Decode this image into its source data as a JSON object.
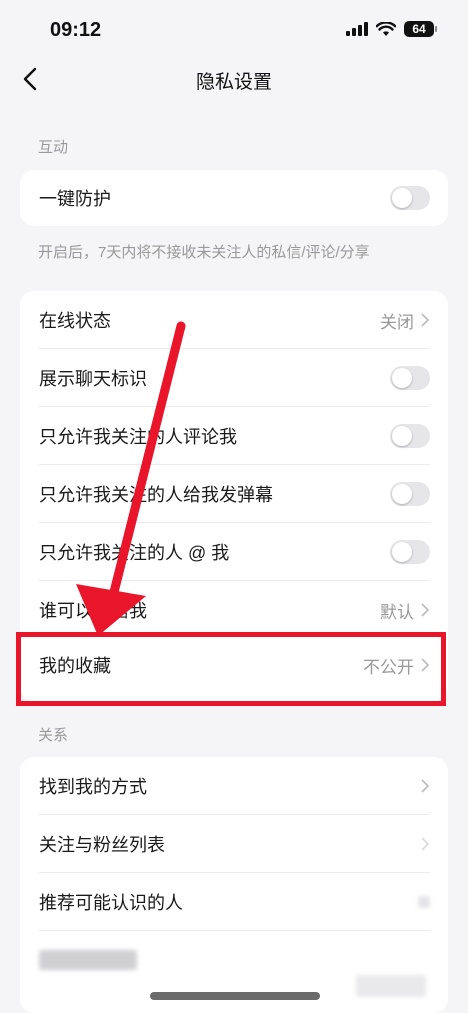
{
  "status": {
    "time": "09:12",
    "battery": "64"
  },
  "header": {
    "title": "隐私设置"
  },
  "sections": {
    "interaction_label": "互动",
    "relation_label": "关系"
  },
  "protection": {
    "label": "一键防护",
    "note": "开启后，7天内将不接收未关注人的私信/评论/分享"
  },
  "settings": {
    "online_status": {
      "label": "在线状态",
      "value": "关闭"
    },
    "show_chat_badge": {
      "label": "展示聊天标识"
    },
    "only_followed_comment": {
      "label": "只允许我关注的人评论我"
    },
    "only_followed_danmaku": {
      "label": "只允许我关注的人给我发弹幕"
    },
    "only_followed_mention": {
      "label": "只允许我关注的人 @ 我"
    },
    "who_can_message": {
      "label": "谁可以私信我",
      "value": "默认"
    },
    "my_favorites": {
      "label": "我的收藏",
      "value": "不公开"
    }
  },
  "relations": {
    "find_me": {
      "label": "找到我的方式"
    },
    "follow_list": {
      "label": "关注与粉丝列表"
    },
    "recommend": {
      "label": "推荐可能认识的人"
    }
  },
  "colors": {
    "highlight": "#e8152b",
    "background": "#f5f5f7"
  }
}
